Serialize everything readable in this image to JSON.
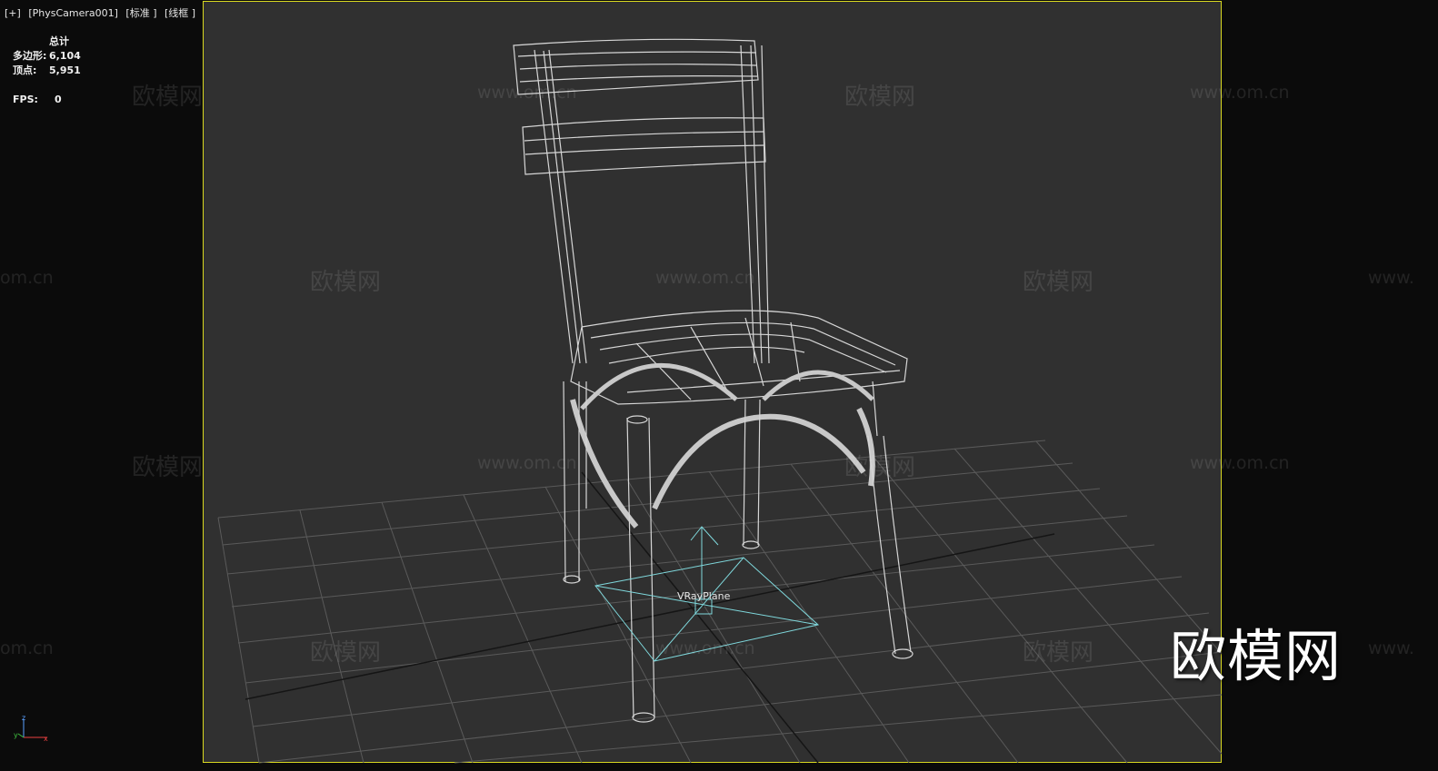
{
  "viewport": {
    "label_items": [
      "[+]",
      "[PhysCamera001]",
      "[标准 ]",
      "[线框 ]"
    ]
  },
  "stats": {
    "header": "总计",
    "polygons_label": "多边形:",
    "polygons_value": "6,104",
    "vertices_label": "顶点:",
    "vertices_value": "5,951",
    "fps_label": "FPS:",
    "fps_value": "0"
  },
  "scene": {
    "object_label": "VRayPlane",
    "wire_color": "#d6d6d6",
    "grid_color": "#5a5a5a",
    "gizmo_color": "#7fd8dc",
    "frame_color": "#d8d820"
  },
  "watermarks": {
    "brand": "欧模网",
    "url": "www.om.cn",
    "url_partial_left": "om.cn",
    "url_partial_right": "www."
  },
  "logo": {
    "text": "欧模网"
  },
  "axis": {
    "z": "z",
    "x": "x",
    "y": "y"
  }
}
